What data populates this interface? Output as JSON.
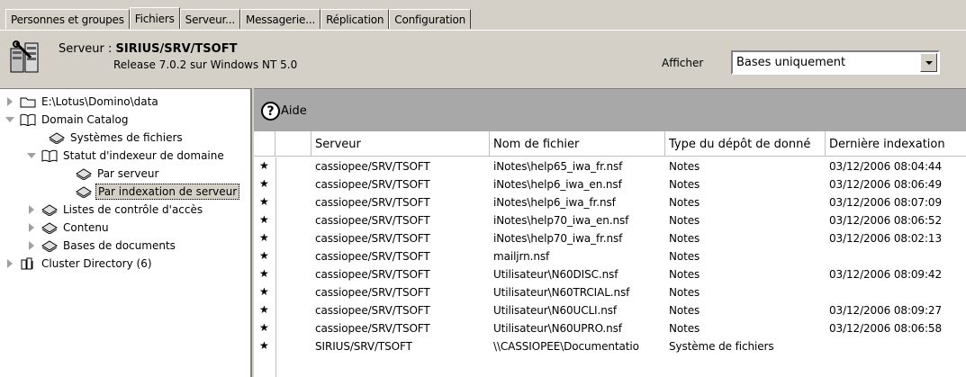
{
  "tabs": [
    {
      "label": "Personnes et groupes",
      "active": false
    },
    {
      "label": "Fichiers",
      "active": true
    },
    {
      "label": "Serveur...",
      "active": false
    },
    {
      "label": "Messagerie...",
      "active": false
    },
    {
      "label": "Réplication",
      "active": false
    },
    {
      "label": "Configuration",
      "active": false
    }
  ],
  "server": {
    "label": "Serveur : ",
    "name": "SIRIUS/SRV/TSOFT",
    "release": "Release 7.0.2 sur Windows NT 5.0",
    "icon": "server-icon"
  },
  "filter": {
    "label": "Afficher",
    "value": "Bases uniquement"
  },
  "tree": {
    "items": [
      {
        "label": "E:\\Lotus\\Domino\\data",
        "icon": "folder-icon"
      },
      {
        "label": "Domain Catalog",
        "icon": "book-icon"
      },
      {
        "label": "Systèmes de fichiers",
        "icon": "database-view-icon"
      },
      {
        "label": "Statut d'indexeur de domaine",
        "icon": "book-icon"
      },
      {
        "label": "Par serveur",
        "icon": "database-view-icon"
      },
      {
        "label": "Par indexation de serveur",
        "icon": "database-view-icon"
      },
      {
        "label": "Listes de contrôle d'accès",
        "icon": "database-view-icon"
      },
      {
        "label": "Contenu",
        "icon": "database-view-icon"
      },
      {
        "label": "Bases de documents",
        "icon": "database-view-icon"
      },
      {
        "label": "Cluster Directory (6)",
        "icon": "cluster-icon"
      }
    ]
  },
  "action_bar": {
    "help_label": "Aide",
    "help_icon_glyph": "?"
  },
  "table": {
    "columns": [
      "Serveur",
      "Nom de fichier",
      "Type du dépôt de donné",
      "Dernière indexation"
    ],
    "rows": [
      {
        "mark": "★",
        "server": "cassiopee/SRV/TSOFT",
        "file": "iNotes\\help65_iwa_fr.nsf",
        "type": "Notes",
        "date": "03/12/2006 08:04:44"
      },
      {
        "mark": "★",
        "server": "cassiopee/SRV/TSOFT",
        "file": "iNotes\\help6_iwa_en.nsf",
        "type": "Notes",
        "date": "03/12/2006 08:06:49"
      },
      {
        "mark": "★",
        "server": "cassiopee/SRV/TSOFT",
        "file": "iNotes\\help6_iwa_fr.nsf",
        "type": "Notes",
        "date": "03/12/2006 08:07:09"
      },
      {
        "mark": "★",
        "server": "cassiopee/SRV/TSOFT",
        "file": "iNotes\\help70_iwa_en.nsf",
        "type": "Notes",
        "date": "03/12/2006 08:06:52"
      },
      {
        "mark": "★",
        "server": "cassiopee/SRV/TSOFT",
        "file": "iNotes\\help70_iwa_fr.nsf",
        "type": "Notes",
        "date": "03/12/2006 08:02:13"
      },
      {
        "mark": "★",
        "server": "cassiopee/SRV/TSOFT",
        "file": "mailjrn.nsf",
        "type": "Notes",
        "date": ""
      },
      {
        "mark": "★",
        "server": "cassiopee/SRV/TSOFT",
        "file": "Utilisateur\\N60DISC.nsf",
        "type": "Notes",
        "date": "03/12/2006 08:09:42"
      },
      {
        "mark": "★",
        "server": "cassiopee/SRV/TSOFT",
        "file": "Utilisateur\\N60TRCIAL.nsf",
        "type": "Notes",
        "date": ""
      },
      {
        "mark": "★",
        "server": "cassiopee/SRV/TSOFT",
        "file": "Utilisateur\\N60UCLI.nsf",
        "type": "Notes",
        "date": "03/12/2006 08:09:27"
      },
      {
        "mark": "★",
        "server": "cassiopee/SRV/TSOFT",
        "file": "Utilisateur\\N60UPRO.nsf",
        "type": "Notes",
        "date": "03/12/2006 08:06:58"
      },
      {
        "mark": "★",
        "server": "SIRIUS/SRV/TSOFT",
        "file": "\\\\CASSIOPEE\\Documentatio",
        "type": "Système de fichiers",
        "date": ""
      }
    ]
  }
}
